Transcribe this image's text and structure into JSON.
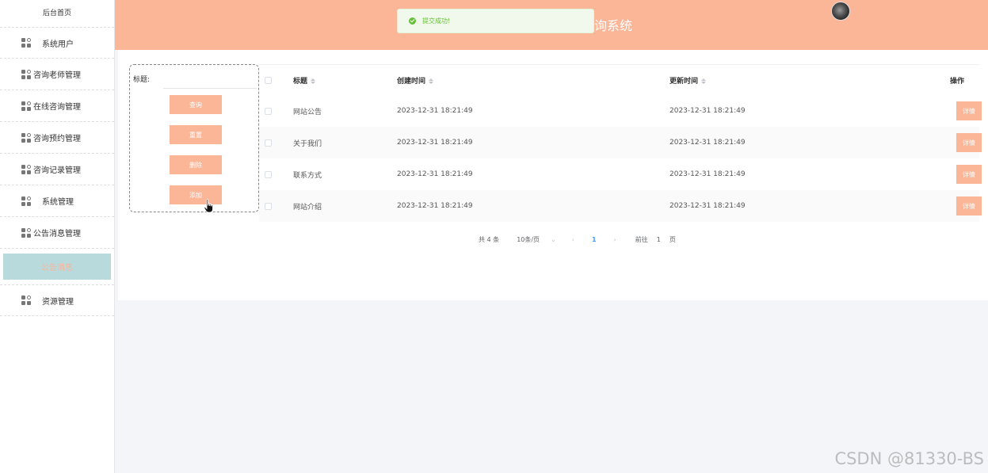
{
  "sidebar": {
    "home": "后台首页",
    "items": [
      {
        "label": "系统用户"
      },
      {
        "label": "咨询老师管理"
      },
      {
        "label": "在线咨询管理"
      },
      {
        "label": "咨询预约管理"
      },
      {
        "label": "咨询记录管理"
      },
      {
        "label": "系统管理"
      },
      {
        "label": "公告消息管理"
      }
    ],
    "active": "公告消息",
    "last": {
      "label": "资源管理"
    }
  },
  "header": {
    "title": "询系统"
  },
  "toast": {
    "message": "提交成功!"
  },
  "search": {
    "label": "标题:",
    "input_value": "",
    "query": "查询",
    "reset": "重置",
    "delete": "删除",
    "add": "添加"
  },
  "table": {
    "columns": {
      "title": "标题",
      "created": "创建时间",
      "updated": "更新时间",
      "op": "操作"
    },
    "rows": [
      {
        "title": "网站公告",
        "created": "2023-12-31 18:21:49",
        "updated": "2023-12-31 18:21:49",
        "op": "详情"
      },
      {
        "title": "关于我们",
        "created": "2023-12-31 18:21:49",
        "updated": "2023-12-31 18:21:49",
        "op": "详情"
      },
      {
        "title": "联系方式",
        "created": "2023-12-31 18:21:49",
        "updated": "2023-12-31 18:21:49",
        "op": "详情"
      },
      {
        "title": "网站介绍",
        "created": "2023-12-31 18:21:49",
        "updated": "2023-12-31 18:21:49",
        "op": "详情"
      }
    ]
  },
  "pager": {
    "total": "共 4 条",
    "size": "10条/页",
    "prev": "‹",
    "current": "1",
    "next": "›",
    "goto": "前往",
    "goto_num": "1",
    "page_unit": "页"
  },
  "watermark": "CSDN @81330-BS",
  "colors": {
    "accent": "#fbb597",
    "active_bg": "#b9dadd",
    "toast_text": "#67c23a"
  }
}
